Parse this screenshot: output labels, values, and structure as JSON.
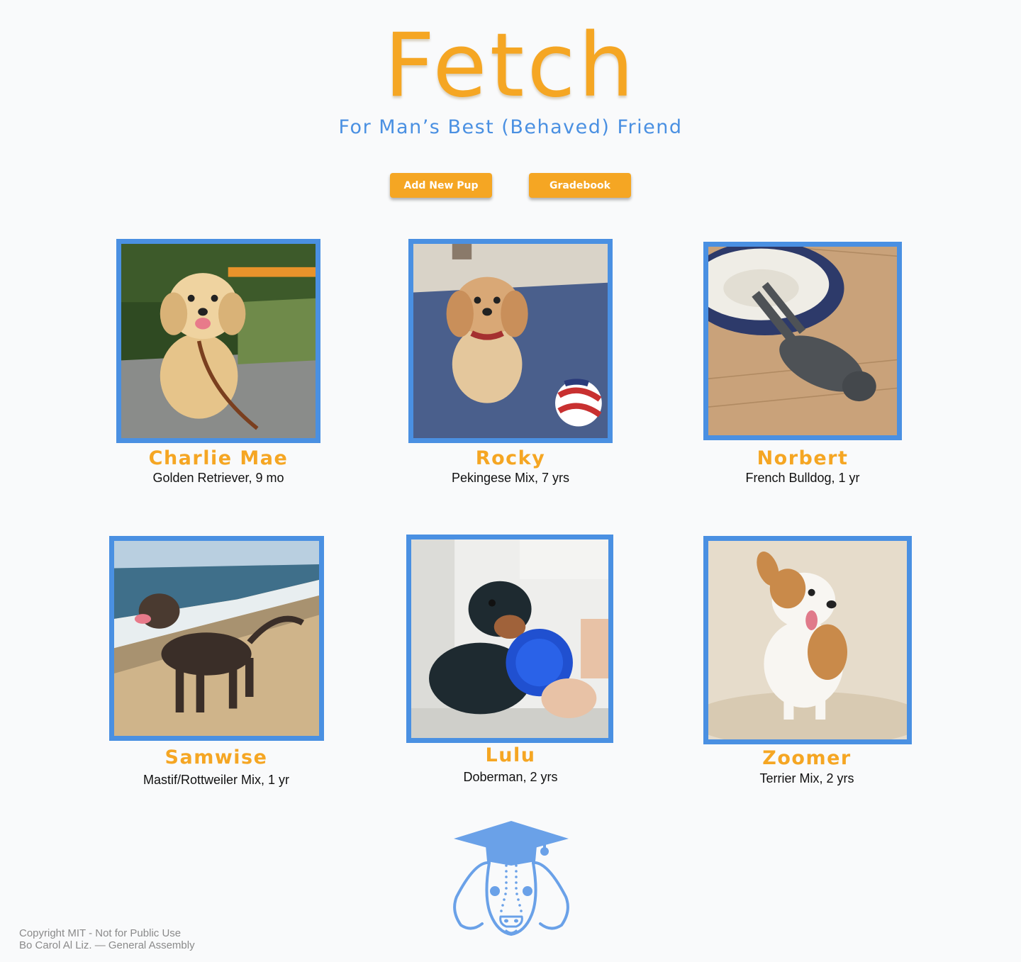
{
  "header": {
    "title": "Fetch",
    "subtitle": "For Man’s Best (Behaved) Friend"
  },
  "actions": {
    "add_label": "Add New Pup",
    "gradebook_label": "Gradebook"
  },
  "pups": [
    {
      "name": "Charlie Mae",
      "info": "Golden Retriever, 9 mo"
    },
    {
      "name": "Rocky",
      "info": "Pekingese Mix, 7 yrs"
    },
    {
      "name": "Norbert",
      "info": "French Bulldog, 1 yr"
    },
    {
      "name": "Samwise",
      "info": "Mastif/Rottweiler Mix, 1 yr"
    },
    {
      "name": "Lulu",
      "info": "Doberman, 2 yrs"
    },
    {
      "name": "Zoomer",
      "info": "Terrier Mix, 2 yrs"
    }
  ],
  "footer": {
    "line1": "Copyright MIT - Not for Public Use",
    "line2": "Bo Carol Al Liz. —  General Assembly"
  },
  "colors": {
    "accent": "#f5a623",
    "brand_blue": "#4a90e2",
    "background": "#f9fafb"
  },
  "icons": {
    "logo": "graduate-dog-logo"
  }
}
